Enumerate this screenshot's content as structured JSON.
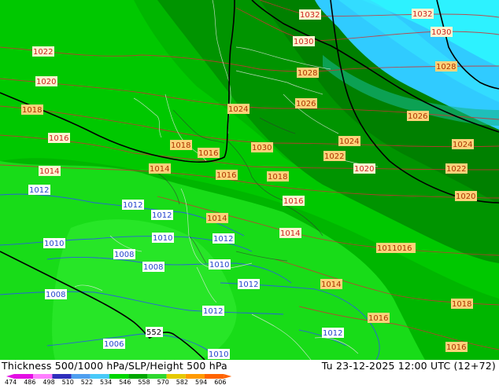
{
  "footer": {
    "title": "Thickness 500/1000 hPa/SLP/Height 500 hPa",
    "time": "Tu 23-12-2025 12:00 UTC (12+72)"
  },
  "legend": {
    "ticks": [
      "474",
      "486",
      "498",
      "510",
      "522",
      "534",
      "546",
      "558",
      "570",
      "582",
      "594",
      "606"
    ],
    "colors": [
      "#e40fe4",
      "#ff7fff",
      "#2d2dbb",
      "#4f9ff0",
      "#49c9f9",
      "#00d500",
      "#00a600",
      "#2fd72f",
      "#e5c900",
      "#ff9a00",
      "#ff6400"
    ]
  },
  "map": {
    "colors": {
      "cyan": "#2df2ff",
      "light_blue": "#30cbff",
      "green_dark": "#009400",
      "green_dark2": "#00b600",
      "green_mid": "#00c800",
      "green_light": "#18dc18",
      "isobar": "#cc3333",
      "blue_line": "#2a55ee",
      "thickness_line": "#000000"
    },
    "isobar_labels": [
      {
        "text": "1032",
        "color": "red"
      },
      {
        "text": "1032",
        "color": "red"
      },
      {
        "text": "1030",
        "color": "red"
      },
      {
        "text": "1030",
        "color": "red"
      },
      {
        "text": "1022",
        "color": "red"
      },
      {
        "text": "1028",
        "color": "orange"
      },
      {
        "text": "1028",
        "color": "orange"
      },
      {
        "text": "1020",
        "color": "red"
      },
      {
        "text": "1018",
        "color": "orange"
      },
      {
        "text": "1024",
        "color": "orange"
      },
      {
        "text": "1026",
        "color": "orange"
      },
      {
        "text": "1026",
        "color": "orange"
      },
      {
        "text": "1016",
        "color": "red"
      },
      {
        "text": "1018",
        "color": "orange"
      },
      {
        "text": "1016",
        "color": "orange"
      },
      {
        "text": "1030",
        "color": "orange"
      },
      {
        "text": "1024",
        "color": "orange"
      },
      {
        "text": "1024",
        "color": "orange"
      },
      {
        "text": "1022",
        "color": "orange"
      },
      {
        "text": "1014",
        "color": "red"
      },
      {
        "text": "1014",
        "color": "orange"
      },
      {
        "text": "1016",
        "color": "orange"
      },
      {
        "text": "1018",
        "color": "orange"
      },
      {
        "text": "1020",
        "color": "red"
      },
      {
        "text": "1022",
        "color": "orange"
      },
      {
        "text": "1012",
        "color": "blue"
      },
      {
        "text": "1020",
        "color": "orange"
      },
      {
        "text": "1012",
        "color": "blue"
      },
      {
        "text": "1012",
        "color": "blue"
      },
      {
        "text": "1016",
        "color": "red"
      },
      {
        "text": "1014",
        "color": "orange"
      },
      {
        "text": "1010",
        "color": "blue"
      },
      {
        "text": "1012",
        "color": "blue"
      },
      {
        "text": "1014",
        "color": "red"
      },
      {
        "text": "1010",
        "color": "blue"
      },
      {
        "text": "1011016",
        "color": "orange"
      },
      {
        "text": "1008",
        "color": "blue"
      },
      {
        "text": "1008",
        "color": "blue"
      },
      {
        "text": "1010",
        "color": "blue"
      },
      {
        "text": "1012",
        "color": "blue"
      },
      {
        "text": "1014",
        "color": "orange"
      },
      {
        "text": "1008",
        "color": "blue"
      },
      {
        "text": "1018",
        "color": "orange"
      },
      {
        "text": "1012",
        "color": "blue"
      },
      {
        "text": "1016",
        "color": "orange"
      },
      {
        "text": "552",
        "color": "black"
      },
      {
        "text": "1012",
        "color": "blue"
      },
      {
        "text": "1006",
        "color": "blue"
      },
      {
        "text": "1016",
        "color": "orange"
      },
      {
        "text": "1010",
        "color": "blue"
      }
    ]
  }
}
